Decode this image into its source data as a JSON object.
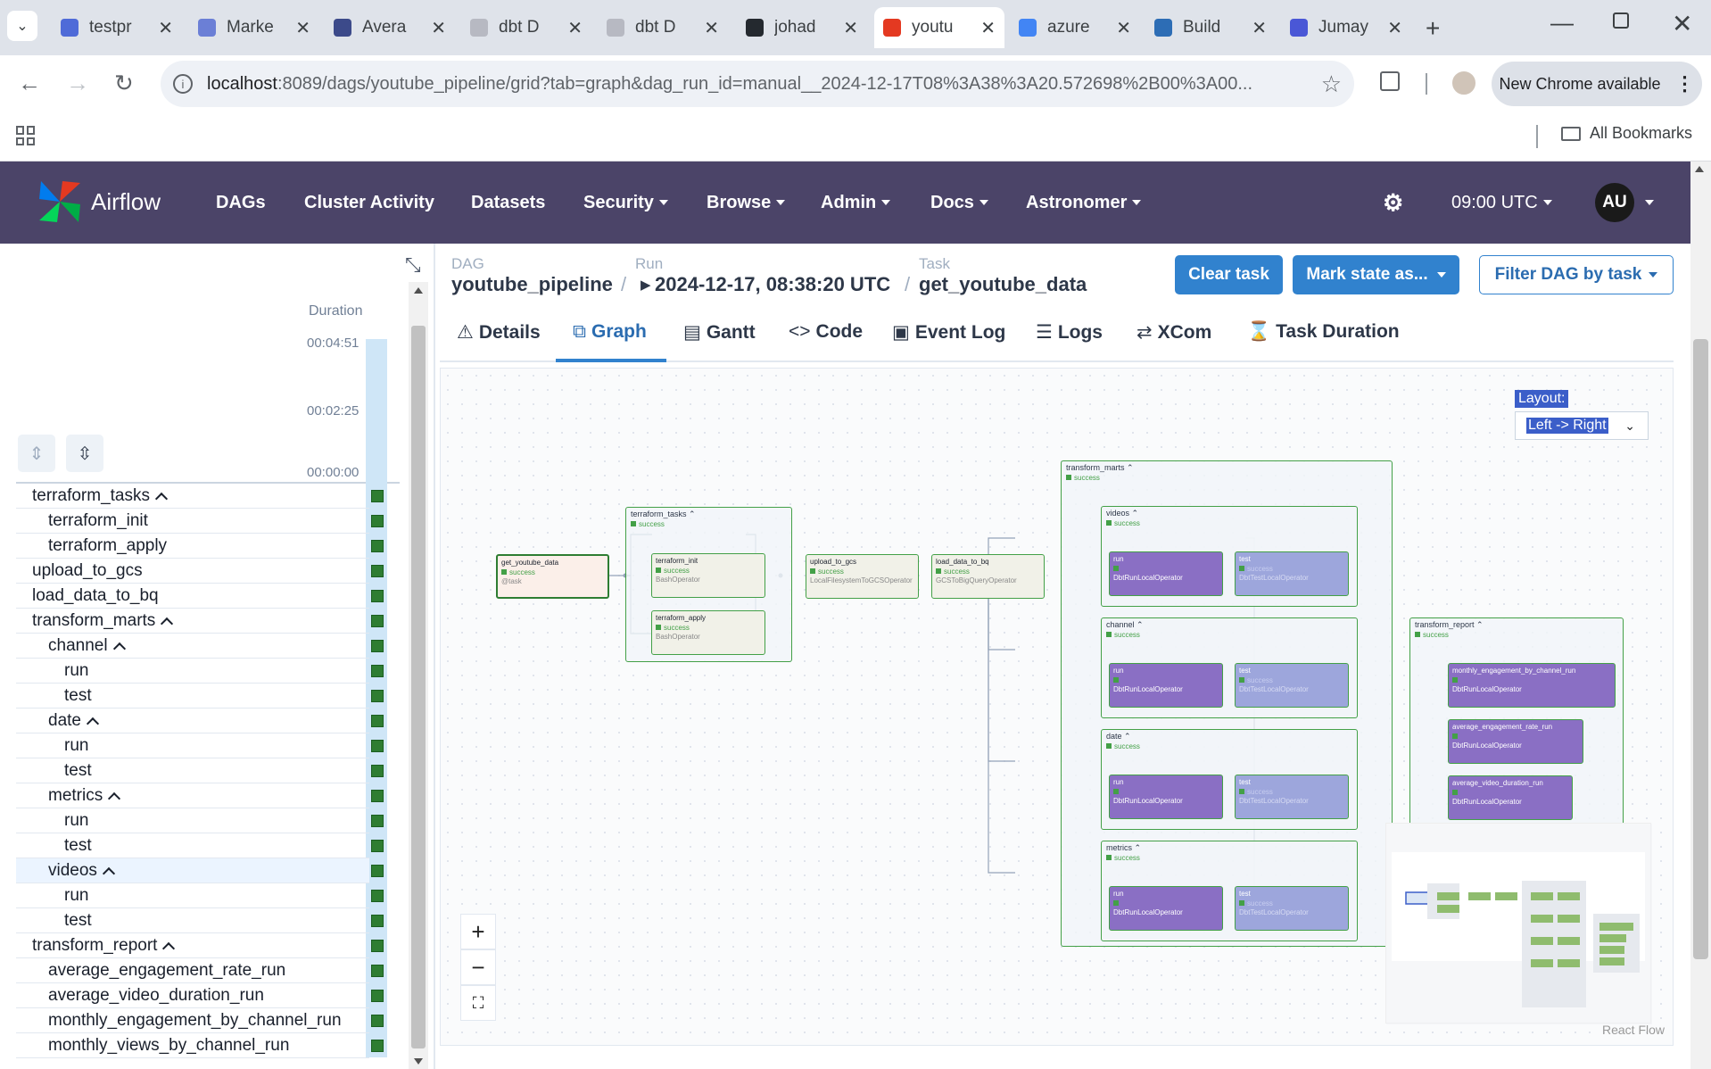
{
  "browser": {
    "tabs": [
      {
        "label": "testpr",
        "icon": "sheets-icon",
        "color": "#4f6bd8"
      },
      {
        "label": "Marke",
        "icon": "dots-icon",
        "color": "#6b7fd6"
      },
      {
        "label": "Avera",
        "icon": "table-icon",
        "color": "#3c4a8a"
      },
      {
        "label": "dbt D",
        "icon": "dbt-icon",
        "color": "#b7b9c2"
      },
      {
        "label": "dbt D",
        "icon": "dbt-icon",
        "color": "#b7b9c2"
      },
      {
        "label": "johad",
        "icon": "github-icon",
        "color": "#24292f"
      },
      {
        "label": "youtu",
        "icon": "airflow-icon",
        "color": "#e43921",
        "active": true
      },
      {
        "label": "azure",
        "icon": "google-icon",
        "color": "#4285f4"
      },
      {
        "label": "Build",
        "icon": "build-icon",
        "color": "#2d6db5"
      },
      {
        "label": "Jumay",
        "icon": "d-icon",
        "color": "#4a57d6"
      }
    ],
    "url_host": "localhost",
    "url_path": ":8089/dags/youtube_pipeline/grid?tab=graph&dag_run_id=manual__2024-12-17T08%3A38%3A20.572698%2B00%3A00...",
    "new_chrome": "New Chrome available",
    "all_bookmarks": "All Bookmarks"
  },
  "airflow": {
    "brand": "Airflow",
    "nav": [
      "DAGs",
      "Cluster Activity",
      "Datasets",
      "Security",
      "Browse",
      "Admin",
      "Docs",
      "Astronomer"
    ],
    "time": "09:00 UTC",
    "user": "AU"
  },
  "left": {
    "duration_label": "Duration",
    "durations": [
      "00:04:51",
      "00:02:25",
      "00:00:00"
    ],
    "tree": [
      {
        "label": "terraform_tasks",
        "indent": 0,
        "expanded": true
      },
      {
        "label": "terraform_init",
        "indent": 1
      },
      {
        "label": "terraform_apply",
        "indent": 1
      },
      {
        "label": "upload_to_gcs",
        "indent": 0
      },
      {
        "label": "load_data_to_bq",
        "indent": 0
      },
      {
        "label": "transform_marts",
        "indent": 0,
        "expanded": true
      },
      {
        "label": "channel",
        "indent": 1,
        "expanded": true
      },
      {
        "label": "run",
        "indent": 2
      },
      {
        "label": "test",
        "indent": 2
      },
      {
        "label": "date",
        "indent": 1,
        "expanded": true
      },
      {
        "label": "run",
        "indent": 2
      },
      {
        "label": "test",
        "indent": 2
      },
      {
        "label": "metrics",
        "indent": 1,
        "expanded": true
      },
      {
        "label": "run",
        "indent": 2
      },
      {
        "label": "test",
        "indent": 2
      },
      {
        "label": "videos",
        "indent": 1,
        "expanded": true,
        "highlight": true
      },
      {
        "label": "run",
        "indent": 2
      },
      {
        "label": "test",
        "indent": 2
      },
      {
        "label": "transform_report",
        "indent": 0,
        "expanded": true
      },
      {
        "label": "average_engagement_rate_run",
        "indent": 1
      },
      {
        "label": "average_video_duration_run",
        "indent": 1
      },
      {
        "label": "monthly_engagement_by_channel_run",
        "indent": 1
      },
      {
        "label": "monthly_views_by_channel_run",
        "indent": 1
      }
    ]
  },
  "header": {
    "dag_key": "DAG",
    "dag": "youtube_pipeline",
    "run_key": "Run",
    "run": "2024-12-17, 08:38:20 UTC",
    "task_key": "Task",
    "task": "get_youtube_data",
    "clear": "Clear task",
    "mark": "Mark state as...",
    "filter": "Filter DAG by task"
  },
  "tabs": [
    {
      "label": "Details",
      "icon": "warning-icon"
    },
    {
      "label": "Graph",
      "icon": "graph-icon",
      "active": true
    },
    {
      "label": "Gantt",
      "icon": "gantt-icon"
    },
    {
      "label": "Code",
      "icon": "code-icon"
    },
    {
      "label": "Event Log",
      "icon": "eventlog-icon"
    },
    {
      "label": "Logs",
      "icon": "logs-icon"
    },
    {
      "label": "XCom",
      "icon": "xcom-icon"
    },
    {
      "label": "Task Duration",
      "icon": "hourglass-icon"
    }
  ],
  "graph": {
    "layout_label": "Layout:",
    "layout_value": "Left -> Right",
    "react_flow": "React Flow",
    "status": "success",
    "groups": {
      "terraform_tasks": "terraform_tasks",
      "transform_marts": "transform_marts",
      "videos": "videos",
      "channel": "channel",
      "date": "date",
      "metrics": "metrics",
      "transform_report": "transform_report"
    },
    "nodes": {
      "get_youtube_data": {
        "name": "get_youtube_data",
        "op": "@task"
      },
      "terraform_init": {
        "name": "terraform_init",
        "op": "BashOperator"
      },
      "terraform_apply": {
        "name": "terraform_apply",
        "op": "BashOperator"
      },
      "upload_to_gcs": {
        "name": "upload_to_gcs",
        "op": "LocalFilesystemToGCSOperator"
      },
      "load_data_to_bq": {
        "name": "load_data_to_bq",
        "op": "GCSToBigQueryOperator"
      },
      "run": {
        "name": "run",
        "op": "DbtRunLocalOperator"
      },
      "test": {
        "name": "test",
        "op": "DbtTestLocalOperator"
      },
      "monthly_engagement": {
        "name": "monthly_engagement_by_channel_run",
        "op": "DbtRunLocalOperator"
      },
      "avg_engagement": {
        "name": "average_engagement_rate_run",
        "op": "DbtRunLocalOperator"
      },
      "avg_duration": {
        "name": "average_video_duration_run",
        "op": "DbtRunLocalOperator"
      }
    }
  }
}
